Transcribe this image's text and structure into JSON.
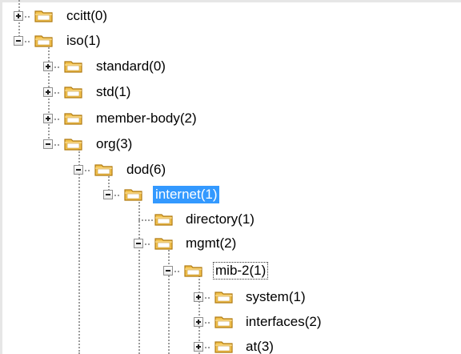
{
  "tree": {
    "nodes": [
      {
        "label": "ccitt(0)",
        "expander": "plus"
      },
      {
        "label": "iso(1)",
        "expander": "minus"
      },
      {
        "label": "standard(0)",
        "expander": "plus"
      },
      {
        "label": "std(1)",
        "expander": "plus"
      },
      {
        "label": "member-body(2)",
        "expander": "plus"
      },
      {
        "label": "org(3)",
        "expander": "minus"
      },
      {
        "label": "dod(6)",
        "expander": "minus"
      },
      {
        "label": "internet(1)",
        "expander": "minus",
        "state": "selected"
      },
      {
        "label": "directory(1)",
        "expander": "none"
      },
      {
        "label": "mgmt(2)",
        "expander": "minus"
      },
      {
        "label": "mib-2(1)",
        "expander": "minus",
        "state": "focused"
      },
      {
        "label": "system(1)",
        "expander": "plus"
      },
      {
        "label": "interfaces(2)",
        "expander": "plus"
      },
      {
        "label": "at(3)",
        "expander": "plus"
      }
    ]
  },
  "colors": {
    "selection": "#3399ff",
    "folder_body": "#f2c24e",
    "folder_edge": "#b07a12"
  },
  "icons": {
    "folder": "folder-icon",
    "expand": "plus-box-icon",
    "collapse": "minus-box-icon"
  }
}
